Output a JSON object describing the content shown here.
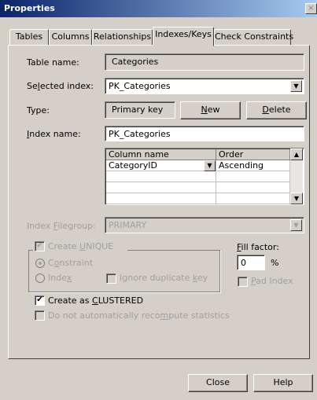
{
  "window": {
    "title": "Properties",
    "close_glyph": "×"
  },
  "tabs": [
    {
      "label": "Tables",
      "active": false
    },
    {
      "label": "Columns",
      "active": false
    },
    {
      "label": "Relationships",
      "active": false
    },
    {
      "label": "Indexes/Keys",
      "active": true
    },
    {
      "label": "Check Constraints",
      "active": false
    }
  ],
  "form": {
    "table_name_label": "Table name:",
    "table_name_value": "Categories",
    "selected_index_label_pre": "Se",
    "selected_index_label_u": "l",
    "selected_index_label_post": "ected index:",
    "selected_index_value": "PK_Categories",
    "type_label": "Type:",
    "type_value": "Primary key",
    "new_button_u": "N",
    "new_button_post": "ew",
    "delete_button_u": "D",
    "delete_button_post": "elete",
    "index_name_label_u": "I",
    "index_name_label_post": "ndex name:",
    "index_name_value": "PK_Categories"
  },
  "grid": {
    "columns": [
      "Column name",
      "Order"
    ],
    "rows": [
      {
        "column_name": "CategoryID",
        "order": "Ascending"
      }
    ]
  },
  "filegroup": {
    "label_pre": "Index ",
    "label_u": "F",
    "label_post": "ilegroup:",
    "value": "PRIMARY"
  },
  "options": {
    "create_unique_pre": "Create ",
    "create_unique_u": "U",
    "create_unique_post": "NIQUE",
    "constraint_pre": "C",
    "constraint_u": "o",
    "constraint_post": "nstraint",
    "index_pre": "Inde",
    "index_u": "x",
    "ignore_dup_pre": "Ignore duplicate ",
    "ignore_dup_u": "k",
    "ignore_dup_post": "ey",
    "fill_factor_u": "F",
    "fill_factor_post": "ill factor:",
    "fill_factor_value": "0",
    "fill_factor_unit": "%",
    "pad_index_pre": "",
    "pad_index_u": "P",
    "pad_index_post": "ad Index",
    "create_clustered_pre": "Create as ",
    "create_clustered_u": "C",
    "create_clustered_post": "LUSTERED",
    "no_recompute_pre": "Do not automatically reco",
    "no_recompute_u": "m",
    "no_recompute_post": "pute statistics"
  },
  "footer": {
    "close_label": "Close",
    "help_label": "Help"
  },
  "icons": {
    "dropdown": "▼",
    "scroll_up": "▲",
    "scroll_down": "▼",
    "check": "✔"
  }
}
